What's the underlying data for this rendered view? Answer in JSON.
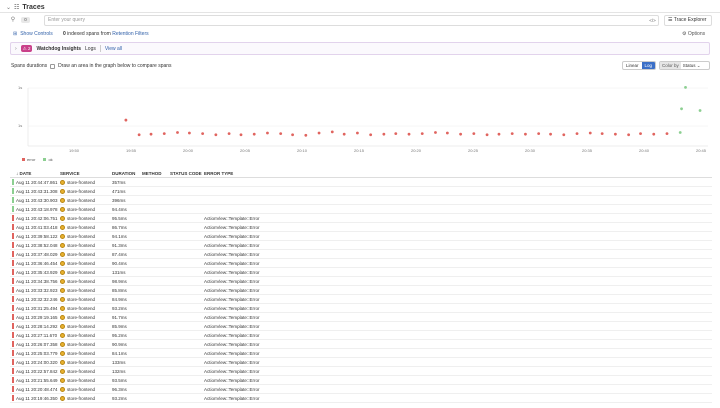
{
  "header": {
    "title": "Traces"
  },
  "search": {
    "count": "0",
    "placeholder": "Enter your query",
    "code_toggle": "</>",
    "explorer_label": "Trace Explorer"
  },
  "subbar": {
    "show_controls": "Show Controls",
    "indexed_count": "0",
    "indexed_text": "indexed spans from",
    "retention_link": "Retention Filters",
    "options": "Options"
  },
  "insights": {
    "count": "2",
    "title": "Watchdog Insights",
    "logs": "Logs",
    "view_all": "View all"
  },
  "chart_controls": {
    "spans_label": "Spans durations",
    "draw_label": "Draw an area in the graph below to compare spans",
    "linear": "Linear",
    "log": "Log",
    "color_by": "Color by",
    "status": "Status"
  },
  "colors": {
    "error": "#e0645f",
    "ok": "#8ccf91",
    "accent": "#3b6fc7"
  },
  "chart_data": {
    "type": "scatter",
    "y_ticks": [
      "1s",
      "1s"
    ],
    "x_ticks": [
      "19:50",
      "19:55",
      "20:00",
      "20:05",
      "20:10",
      "20:15",
      "20:20",
      "20:25",
      "20:30",
      "20:35",
      "20:40",
      "20:45"
    ],
    "log_scale": true,
    "series": [
      {
        "name": "error",
        "points": [
          [
            19.0,
            96
          ],
          [
            20.0,
            70
          ],
          [
            20.9,
            71
          ],
          [
            21.9,
            72
          ],
          [
            22.9,
            74
          ],
          [
            23.8,
            73
          ],
          [
            24.8,
            72
          ],
          [
            25.8,
            70
          ],
          [
            26.8,
            72
          ],
          [
            27.7,
            70
          ],
          [
            28.7,
            71
          ],
          [
            29.7,
            73
          ],
          [
            30.7,
            72
          ],
          [
            31.6,
            70
          ],
          [
            32.6,
            69
          ],
          [
            33.6,
            73
          ],
          [
            34.6,
            75
          ],
          [
            35.5,
            71
          ],
          [
            36.5,
            73
          ],
          [
            37.5,
            70
          ],
          [
            38.5,
            71
          ],
          [
            39.4,
            72
          ],
          [
            40.4,
            71
          ],
          [
            41.4,
            72
          ],
          [
            42.4,
            74
          ],
          [
            43.3,
            73
          ],
          [
            44.3,
            71
          ],
          [
            45.3,
            72
          ],
          [
            46.3,
            70
          ],
          [
            47.2,
            71
          ],
          [
            48.2,
            72
          ],
          [
            49.2,
            71
          ],
          [
            50.2,
            72
          ],
          [
            51.1,
            71
          ],
          [
            52.1,
            70
          ],
          [
            53.1,
            72
          ],
          [
            54.1,
            73
          ],
          [
            55.0,
            72
          ],
          [
            56.0,
            71
          ],
          [
            57.0,
            70
          ],
          [
            57.9,
            72
          ],
          [
            58.9,
            71
          ],
          [
            59.9,
            72
          ]
        ]
      },
      {
        "name": "ok",
        "points": [
          [
            60.9,
            74
          ],
          [
            61.3,
            154
          ],
          [
            61.0,
            116
          ],
          [
            62.4,
            113
          ]
        ]
      }
    ],
    "legend": [
      "error",
      "ok"
    ]
  },
  "table": {
    "columns": [
      "Date",
      "Service",
      "Duration",
      "Method",
      "Status Code",
      "Error Type"
    ],
    "rows": [
      {
        "date": "Aug 11 20:44:47.861",
        "service": "store-frontend",
        "duration": "357ms",
        "error_type": "",
        "status": "ok"
      },
      {
        "date": "Aug 11 20:43:31.308",
        "service": "store-frontend",
        "duration": "471ms",
        "error_type": "",
        "status": "ok"
      },
      {
        "date": "Aug 11 20:43:30.903",
        "service": "store-frontend",
        "duration": "396ms",
        "error_type": "",
        "status": "ok"
      },
      {
        "date": "Aug 11 20:43:18.978",
        "service": "store-frontend",
        "duration": "94.4ms",
        "error_type": "",
        "status": "ok"
      },
      {
        "date": "Aug 11 20:42:06.751",
        "service": "store-frontend",
        "duration": "95.5ms",
        "error_type": "ActionView::Template::Error",
        "status": "error"
      },
      {
        "date": "Aug 11 20:41:03.418",
        "service": "store-frontend",
        "duration": "86.7ms",
        "error_type": "ActionView::Template::Error",
        "status": "error"
      },
      {
        "date": "Aug 11 20:39:58.122",
        "service": "store-frontend",
        "duration": "94.1ms",
        "error_type": "ActionView::Template::Error",
        "status": "error"
      },
      {
        "date": "Aug 11 20:38:52.048",
        "service": "store-frontend",
        "duration": "91.3ms",
        "error_type": "ActionView::Template::Error",
        "status": "error"
      },
      {
        "date": "Aug 11 20:37:48.029",
        "service": "store-frontend",
        "duration": "87.4ms",
        "error_type": "ActionView::Template::Error",
        "status": "error"
      },
      {
        "date": "Aug 11 20:36:46.454",
        "service": "store-frontend",
        "duration": "90.4ms",
        "error_type": "ActionView::Template::Error",
        "status": "error"
      },
      {
        "date": "Aug 11 20:35:43.929",
        "service": "store-frontend",
        "duration": "131ms",
        "error_type": "ActionView::Template::Error",
        "status": "error"
      },
      {
        "date": "Aug 11 20:34:38.756",
        "service": "store-frontend",
        "duration": "98.9ms",
        "error_type": "ActionView::Template::Error",
        "status": "error"
      },
      {
        "date": "Aug 11 20:33:32.923",
        "service": "store-frontend",
        "duration": "85.8ms",
        "error_type": "ActionView::Template::Error",
        "status": "error"
      },
      {
        "date": "Aug 11 20:32:32.246",
        "service": "store-frontend",
        "duration": "84.9ms",
        "error_type": "ActionView::Template::Error",
        "status": "error"
      },
      {
        "date": "Aug 11 20:31:25.494",
        "service": "store-frontend",
        "duration": "93.2ms",
        "error_type": "ActionView::Template::Error",
        "status": "error"
      },
      {
        "date": "Aug 11 20:29:19.165",
        "service": "store-frontend",
        "duration": "91.7ms",
        "error_type": "ActionView::Template::Error",
        "status": "error"
      },
      {
        "date": "Aug 11 20:28:14.292",
        "service": "store-frontend",
        "duration": "85.9ms",
        "error_type": "ActionView::Template::Error",
        "status": "error"
      },
      {
        "date": "Aug 11 20:27:11.670",
        "service": "store-frontend",
        "duration": "95.2ms",
        "error_type": "ActionView::Template::Error",
        "status": "error"
      },
      {
        "date": "Aug 11 20:26:07.358",
        "service": "store-frontend",
        "duration": "90.9ms",
        "error_type": "ActionView::Template::Error",
        "status": "error"
      },
      {
        "date": "Aug 11 20:25:03.779",
        "service": "store-frontend",
        "duration": "84.1ms",
        "error_type": "ActionView::Template::Error",
        "status": "error"
      },
      {
        "date": "Aug 11 20:24:00.320",
        "service": "store-frontend",
        "duration": "133ms",
        "error_type": "ActionView::Template::Error",
        "status": "error"
      },
      {
        "date": "Aug 11 20:22:57.842",
        "service": "store-frontend",
        "duration": "132ms",
        "error_type": "ActionView::Template::Error",
        "status": "error"
      },
      {
        "date": "Aug 11 20:21:55.649",
        "service": "store-frontend",
        "duration": "93.5ms",
        "error_type": "ActionView::Template::Error",
        "status": "error"
      },
      {
        "date": "Aug 11 20:20:48.474",
        "service": "store-frontend",
        "duration": "96.3ms",
        "error_type": "ActionView::Template::Error",
        "status": "error"
      },
      {
        "date": "Aug 11 20:19:46.350",
        "service": "store-frontend",
        "duration": "93.2ms",
        "error_type": "ActionView::Template::Error",
        "status": "error"
      }
    ]
  }
}
